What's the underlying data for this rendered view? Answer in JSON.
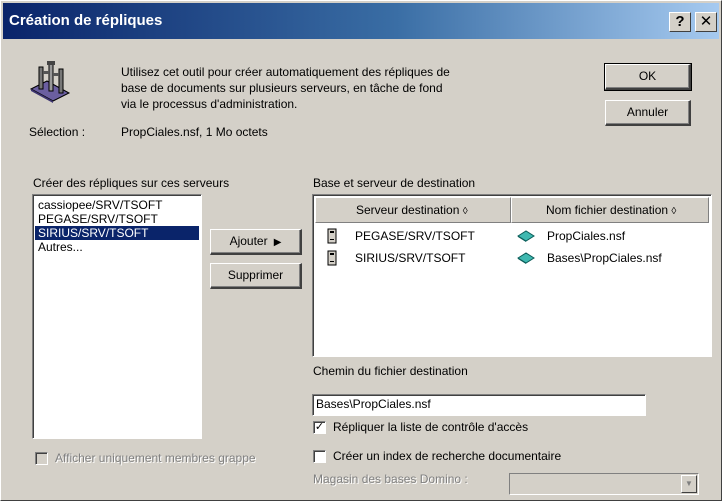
{
  "window": {
    "title": "Création de répliques",
    "help_label": "?",
    "close_label": "✕"
  },
  "header": {
    "description_line1": "Utilisez cet outil pour créer automatiquement des répliques de",
    "description_line2": "base de documents sur plusieurs serveurs, en tâche de fond",
    "description_line3": "via le processus d'administration.",
    "selection_label": "Sélection :",
    "selection_value": "PropCiales.nsf, 1 Mo octets"
  },
  "buttons": {
    "ok": "OK",
    "cancel": "Annuler",
    "add": "Ajouter",
    "remove": "Supprimer"
  },
  "servers": {
    "label": "Créer des répliques sur ces serveurs",
    "items": [
      "cassiopee/SRV/TSOFT",
      "PEGASE/SRV/TSOFT",
      "SIRIUS/SRV/TSOFT",
      "Autres..."
    ],
    "selected_index": 2,
    "show_cluster_only_label": "Afficher uniquement membres grappe",
    "show_cluster_only_checked": false
  },
  "destination": {
    "label": "Base et serveur de destination",
    "columns": [
      "Serveur destination",
      "Nom fichier destination"
    ],
    "rows": [
      {
        "server": "PEGASE/SRV/TSOFT",
        "file": "PropCiales.nsf"
      },
      {
        "server": "SIRIUS/SRV/TSOFT",
        "file": "Bases\\PropCiales.nsf"
      }
    ]
  },
  "options": {
    "path_label": "Chemin du fichier destination",
    "path_value": "Bases\\PropCiales.nsf",
    "replicate_acl_label": "Répliquer la liste de contrôle d'accès",
    "replicate_acl_checked": true,
    "fulltext_index_label": "Créer un index de recherche documentaire",
    "fulltext_index_checked": false,
    "domino_store_label": "Magasin des bases Domino :",
    "domino_store_value": ""
  }
}
